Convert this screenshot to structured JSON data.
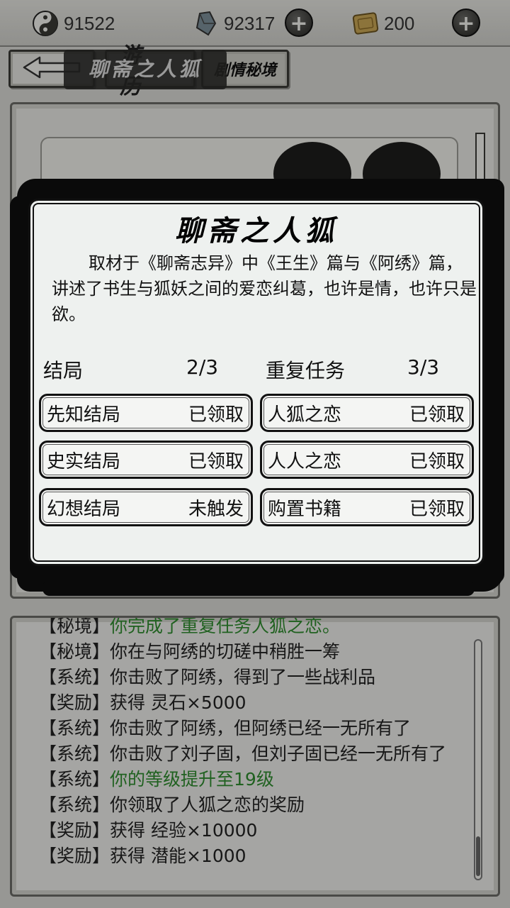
{
  "resources": [
    {
      "icon": "yin-yang-icon",
      "value": "91522"
    },
    {
      "icon": "crystal-gem-icon",
      "value": "92317"
    },
    {
      "icon": "gold-ingot-icon",
      "value": "200"
    }
  ],
  "nav": {
    "back_icon": "left-arrow-icon",
    "tab_travel": "游 历",
    "tab_story": "剧情秘境"
  },
  "background_card": {
    "title": "聊斋之人狐"
  },
  "modal": {
    "title": "聊斋之人狐",
    "description": "取材于《聊斋志异》中《王生》篇与《阿绣》篇，讲述了书生与狐妖之间的爱恋纠葛，也许是情，也许只是欲。",
    "endings": {
      "label": "结局",
      "progress": "2/3",
      "items": [
        {
          "name": "先知结局",
          "status": "已领取"
        },
        {
          "name": "史实结局",
          "status": "已领取"
        },
        {
          "name": "幻想结局",
          "status": "未触发"
        }
      ]
    },
    "repeat_tasks": {
      "label": "重复任务",
      "progress": "3/3",
      "items": [
        {
          "name": "人狐之恋",
          "status": "已领取"
        },
        {
          "name": "人人之恋",
          "status": "已领取"
        },
        {
          "name": "购置书籍",
          "status": "已领取"
        }
      ]
    }
  },
  "log": [
    {
      "tag": "【秘境】",
      "text": "你完成了重复任务人狐之恋。",
      "color": "#2e8b2e"
    },
    {
      "tag": "【秘境】",
      "text": "你在与阿绣的切磋中稍胜一筹",
      "color": "#222222"
    },
    {
      "tag": "【系统】",
      "text": "你击败了阿绣，得到了一些战利品",
      "color": "#222222"
    },
    {
      "tag": "【奖励】",
      "text": "获得 灵石×5000",
      "color": "#222222"
    },
    {
      "tag": "【系统】",
      "text": "你击败了阿绣，但阿绣已经一无所有了",
      "color": "#222222"
    },
    {
      "tag": "【系统】",
      "text": "你击败了刘子固，但刘子固已经一无所有了",
      "color": "#222222"
    },
    {
      "tag": "【系统】",
      "text": "你的等级提升至19级",
      "color": "#2e8b2e"
    },
    {
      "tag": "【系统】",
      "text": "你领取了人狐之恋的奖励",
      "color": "#222222"
    },
    {
      "tag": "【奖励】",
      "text": "获得 经验×10000",
      "color": "#222222"
    },
    {
      "tag": "【奖励】",
      "text": "获得 潜能×1000",
      "color": "#222222"
    }
  ]
}
